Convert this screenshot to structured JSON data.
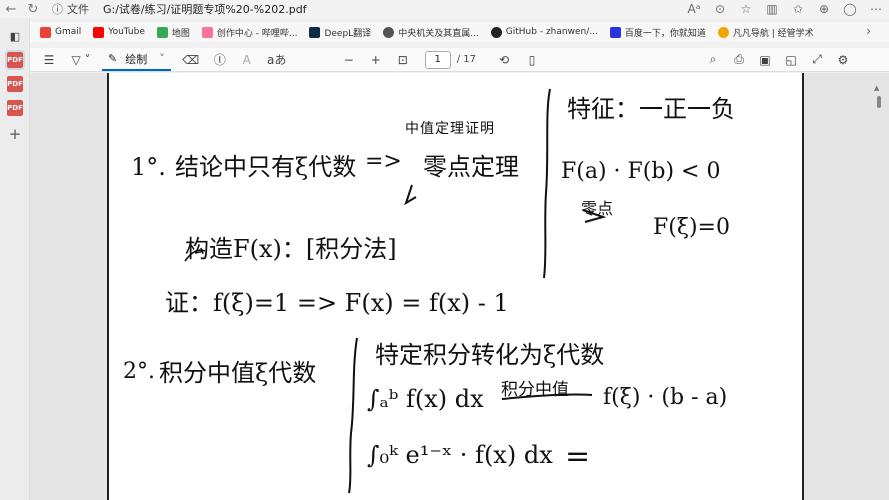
{
  "browser": {
    "file_label": "文件",
    "url": "G:/试卷/练习/证明题专项%20-%202.pdf"
  },
  "bookmarks": [
    {
      "label": "Gmail",
      "color": "#ea4335"
    },
    {
      "label": "YouTube",
      "color": "#ff0000"
    },
    {
      "label": "地图",
      "color": "#34a853"
    },
    {
      "label": "创作中心 - 哔哩哔...",
      "color": "#fb7299"
    },
    {
      "label": "DeepL翻译",
      "color": "#0f2b46"
    },
    {
      "label": "中央机关及其直属...",
      "color": "#555555"
    },
    {
      "label": "GitHub - zhanwen/...",
      "color": "#222222"
    },
    {
      "label": "百度一下，你就知道",
      "color": "#2932e1"
    },
    {
      "label": "凡凡导航 | 经管学术",
      "color": "#f0a500"
    }
  ],
  "toolbar": {
    "draw_label": "绘制",
    "text_size_label": "aあ",
    "current_page": "1",
    "page_count": "/ 17"
  },
  "notes": {
    "annotation": "中值定理证明",
    "l1_num": "1°.",
    "l1_text": "结论中只有ξ代数",
    "l1_arrow": "=>",
    "l1_tail": "零点定理",
    "l2": "构造F(x)：[积分法]",
    "l3": "证：f(ξ)=1  =>  F(x) = f(x) - 1",
    "r1": "特征：一正一负",
    "r2": "F(a) · F(b) < 0",
    "r3_label": "零点",
    "r3": "F(ξ)=0",
    "l4_num": "2°.",
    "l4_text": "积分中值ξ代数",
    "r4": "特定积分转化为ξ代数",
    "r5_int": "∫ₐᵇ f(x) dx",
    "r5_label": "积分中值",
    "r5_res": "f(ξ) · (b - a)",
    "r6_int": "∫₀ᵏ e¹⁻ˣ · f(x) dx",
    "r6_eq": "="
  }
}
